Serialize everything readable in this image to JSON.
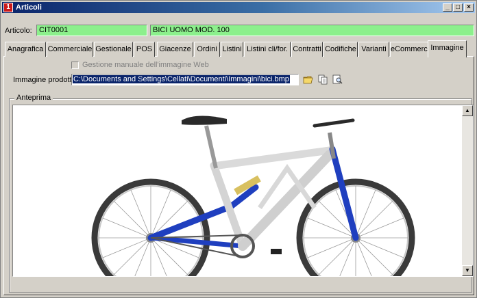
{
  "window": {
    "title": "Articoli",
    "title_icon": "1",
    "buttons": {
      "minimize": "_",
      "maximize": "□",
      "close": "×"
    }
  },
  "article": {
    "label": "Articolo:",
    "code": "CIT0001",
    "description": "BICI UOMO MOD. 100"
  },
  "tabs": [
    {
      "label": "Anagrafica"
    },
    {
      "label": "Commerciale"
    },
    {
      "label": "Gestionale"
    },
    {
      "label": "POS"
    },
    {
      "label": "Giacenze"
    },
    {
      "label": "Ordini"
    },
    {
      "label": "Listini"
    },
    {
      "label": "Listini cli/for."
    },
    {
      "label": "Contratti"
    },
    {
      "label": "Codifiche"
    },
    {
      "label": "Varianti"
    },
    {
      "label": "eCommerce"
    },
    {
      "label": "Immagine"
    }
  ],
  "active_tab": "Immagine",
  "image_tab": {
    "manual_web_label": "Gestione manuale dell'immagine Web",
    "manual_web_checked": false,
    "product_image_label": "Immagine prodotto:",
    "product_image_path": "C:\\Documents and Settings\\Cellati\\Documenti\\Immagini\\bici.bmp",
    "icons": [
      "folder-open-icon",
      "copy-icon",
      "preview-icon"
    ],
    "preview_group_label": "Anteprima"
  },
  "colors": {
    "titlebar_start": "#0a246a",
    "field_green": "#8cf08c",
    "frame_blue": "#1f3fbf",
    "frame_silver": "#d9d9d9"
  }
}
